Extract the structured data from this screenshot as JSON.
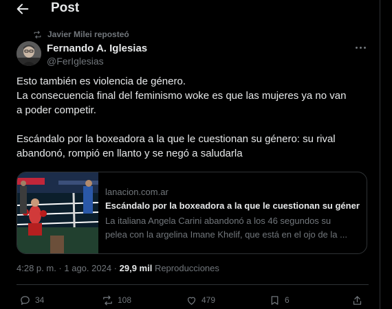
{
  "header": {
    "title": "Post"
  },
  "repost_banner": {
    "text": "Javier Milei reposteó"
  },
  "author": {
    "name": "Fernando A. Iglesias",
    "handle": "@FerIglesias"
  },
  "tweet": {
    "lines": [
      "Esto también es violencia de género.",
      "La consecuencia final del feminismo woke es que las mujeres ya no van",
      "a poder competir.",
      "",
      "Escándalo por la boxeadora a la que le cuestionan su género: su rival",
      "abandonó, rompió en llanto y se negó a saludarla"
    ]
  },
  "link_card": {
    "domain": "lanacion.com.ar",
    "title": "Escándalo por la boxeadora a la que le cuestionan su género",
    "description_lines": [
      "La italiana Angela Carini abandonó a los 46 segundos su",
      "pelea con la argelina Imane Khelif, que está en el ojo de la ..."
    ]
  },
  "meta": {
    "time": "4:28 p. m.",
    "separator1": " · ",
    "date": "1 ago. 2024",
    "separator2": " · ",
    "views_count": "29,9 mil",
    "views_label": " Reproducciones"
  },
  "actions": {
    "replies": "34",
    "reposts": "108",
    "likes": "479",
    "bookmarks": "6"
  },
  "colors": {
    "background": "#000000",
    "text": "#e7e9ea",
    "secondary_text": "#71767b",
    "border": "#2f3336"
  }
}
